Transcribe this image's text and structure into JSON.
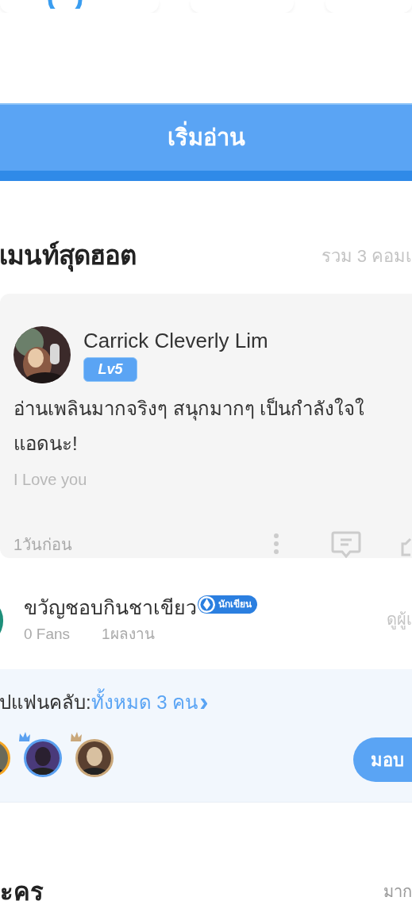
{
  "start_button": {
    "label": "เริ่มอ่าน"
  },
  "hot_comments": {
    "title": "เมนท์สุดฮอต",
    "total": "รวม 3 คอมเ"
  },
  "comment": {
    "user": "Carrick Cleverly Lim",
    "level": "Lv5",
    "lines": [
      "อ่านเพลินมากจริงๆ สนุกมากๆ เป็นกำลังใจใ",
      "แอดนะ!"
    ],
    "signature": "I Love you",
    "time": "1วันก่อน"
  },
  "author": {
    "name": "ขวัญชอบกินชาเขียว",
    "badge": "นักเขียน",
    "fans": "0 Fans",
    "works": "1ผลงาน",
    "link": "ดูผู้เ"
  },
  "fan_club": {
    "label": "ปแฟนคลับ:",
    "count": "ทั้งหมด 3 คน",
    "chevron": "›",
    "members": [
      {
        "color": "#f5a623"
      },
      {
        "color": "#5aa0f0"
      },
      {
        "color": "#c9a77a"
      }
    ],
    "button": "มอบ"
  },
  "characters": {
    "title": "ะคร",
    "more": "มาก"
  }
}
